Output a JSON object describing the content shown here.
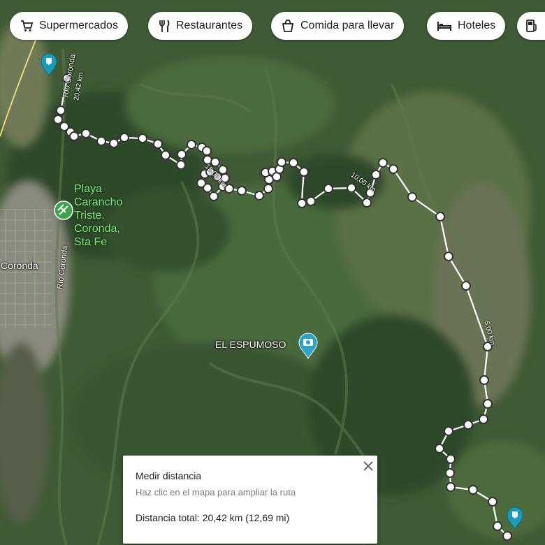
{
  "categories": [
    {
      "label": "Supermercados",
      "icon": "cart-icon"
    },
    {
      "label": "Restaurantes",
      "icon": "fork-knife-icon"
    },
    {
      "label": "Comida para llevar",
      "icon": "takeout-icon"
    },
    {
      "label": "Hoteles",
      "icon": "bed-icon"
    },
    {
      "label": "",
      "icon": "gas-station-icon"
    }
  ],
  "places": {
    "playa_line1": "Playa",
    "playa_line2": "Carancho",
    "playa_line3": "Triste.",
    "playa_line4": "Coronda,",
    "playa_line5": "Sta Fe",
    "town": "Coronda",
    "espumoso": "EL ESPUMOSO",
    "river_top": "Río Coronda",
    "river_left": "Río Coronda"
  },
  "route_labels": {
    "start_distance": "20,42 km",
    "km15": "15,00 km",
    "km10": "10,00 km",
    "km5": "5,00 km"
  },
  "measure_panel": {
    "title": "Medir distancia",
    "hint": "Haz clic en el mapa para ampliar la ruta",
    "total": "Distancia total: 20,42 km (12,69 mi)"
  },
  "colors": {
    "route": "#ffffff",
    "marker": "#1a9bb8",
    "place_label": "#7fe07a"
  }
}
